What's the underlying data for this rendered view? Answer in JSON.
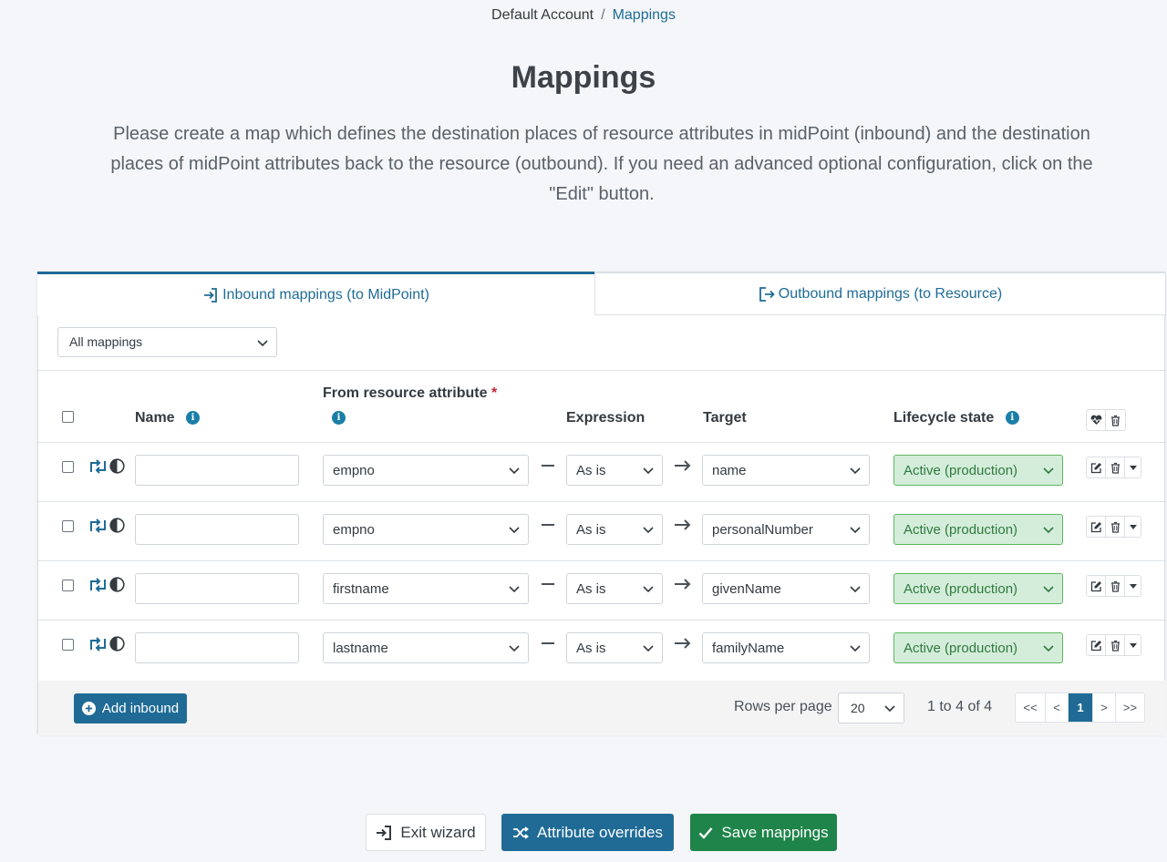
{
  "breadcrumb": {
    "parent": "Default Account",
    "separator": "/",
    "current": "Mappings"
  },
  "page": {
    "title": "Mappings",
    "description": "Please create a map which defines the destination places of resource attributes in midPoint (inbound) and the destination places of midPoint attributes back to the resource (outbound). If you need an advanced optional configuration, click on the \"Edit\" button."
  },
  "tabs": {
    "inbound": "Inbound mappings (to MidPoint)",
    "outbound": "Outbound mappings (to Resource)"
  },
  "filter": {
    "value": "All mappings"
  },
  "columns": {
    "name": "Name",
    "from_attribute": "From resource attribute",
    "required_mark": "*",
    "expression": "Expression",
    "target": "Target",
    "lifecycle": "Lifecycle state"
  },
  "rows": [
    {
      "name": "",
      "from": "empno",
      "expression": "As is",
      "target": "name",
      "lifecycle": "Active (production)"
    },
    {
      "name": "",
      "from": "empno",
      "expression": "As is",
      "target": "personalNumber",
      "lifecycle": "Active (production)"
    },
    {
      "name": "",
      "from": "firstname",
      "expression": "As is",
      "target": "givenName",
      "lifecycle": "Active (production)"
    },
    {
      "name": "",
      "from": "lastname",
      "expression": "As is",
      "target": "familyName",
      "lifecycle": "Active (production)"
    }
  ],
  "footer": {
    "add_label": "Add inbound",
    "rows_per_page_label": "Rows per page",
    "rows_per_page_value": "20",
    "count_text": "1 to 4 of 4",
    "pager": {
      "first": "<<",
      "prev": "<",
      "page": "1",
      "next": ">",
      "last": ">>"
    }
  },
  "actions": {
    "exit": "Exit wizard",
    "overrides": "Attribute overrides",
    "save": "Save mappings"
  },
  "colors": {
    "primary": "#1f6b96",
    "success": "#1e8449",
    "active_bg": "#d4edda"
  }
}
